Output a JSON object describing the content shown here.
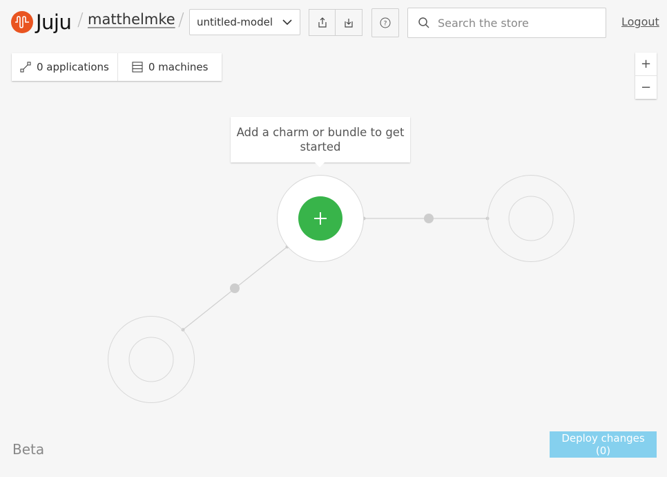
{
  "header": {
    "brand": "Juju",
    "separator": "/",
    "user": "matthelmke",
    "model": "untitled-model",
    "search_placeholder": "Search the store",
    "logout": "Logout"
  },
  "counts": {
    "applications": "0 applications",
    "machines": "0 machines"
  },
  "zoom": {
    "in": "+",
    "out": "−"
  },
  "canvas": {
    "tooltip": "Add a charm or bundle to get started"
  },
  "footer": {
    "beta": "Beta",
    "deploy": "Deploy changes (0)"
  },
  "colors": {
    "brand_orange": "#e95420",
    "add_green": "#38b44a",
    "deploy_blue": "#85d0ee"
  },
  "icons": [
    "juju-logo-icon",
    "chevron-down-icon",
    "share-icon",
    "import-icon",
    "help-icon",
    "search-icon",
    "applications-icon",
    "machines-icon",
    "plus-icon"
  ]
}
